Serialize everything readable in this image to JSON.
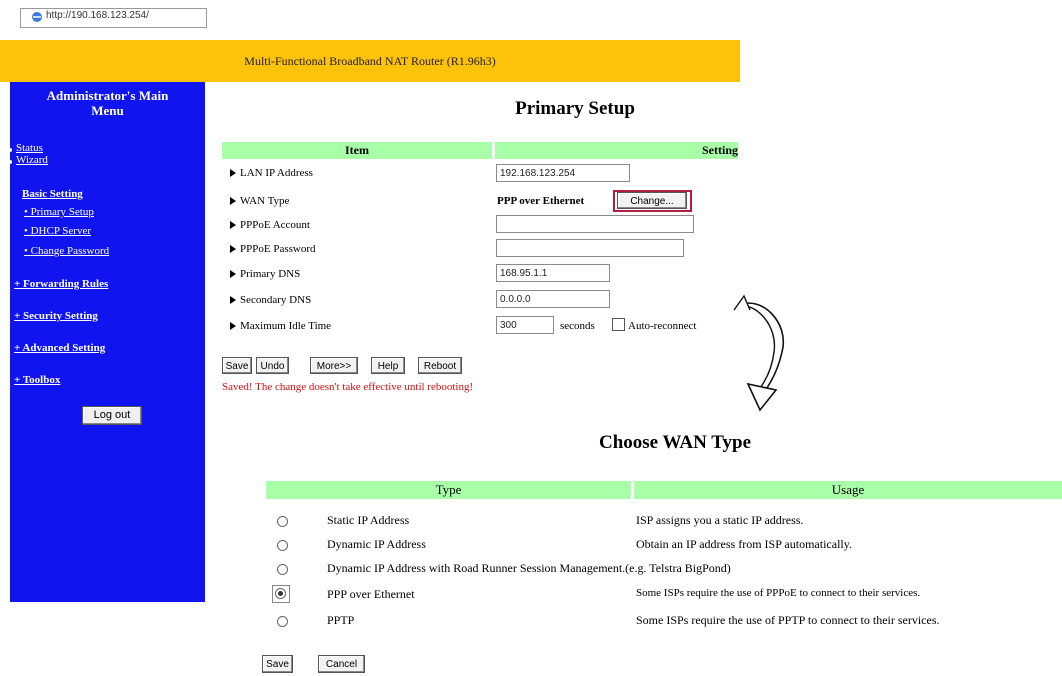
{
  "browser": {
    "url": "http://190.168.123.254/"
  },
  "banner": {
    "text": "Multi-Functional Broadband NAT Router (R1.96h3)"
  },
  "menu": {
    "title_line1": "Administrator's Main",
    "title_line2": "Menu",
    "status": "Status",
    "wizard": "Wizard",
    "basic_setting": "Basic Setting",
    "primary_setup": "Primary Setup",
    "dhcp_server": "DHCP Server",
    "change_password": "Change Password",
    "forwarding_rules": "+ Forwarding Rules",
    "security_setting": "+ Security Setting",
    "advanced_setting": "+ Advanced Setting",
    "toolbox": "+ Toolbox",
    "logout": "Log out"
  },
  "primary_setup": {
    "title": "Primary Setup",
    "col_item": "Item",
    "col_setting": "Setting",
    "rows": [
      {
        "label": "LAN IP Address",
        "value": "192.168.123.254"
      },
      {
        "label": "WAN Type",
        "value": "PPP over Ethernet"
      },
      {
        "label": "PPPoE Account",
        "value": ""
      },
      {
        "label": "PPPoE Password",
        "value": ""
      },
      {
        "label": "Primary DNS",
        "value": "168.95.1.1"
      },
      {
        "label": "Secondary DNS",
        "value": "0.0.0.0"
      },
      {
        "label": "Maximum Idle Time",
        "value": "300"
      }
    ],
    "change_button": "Change...",
    "seconds_label": "seconds",
    "auto_reconnect_label": "Auto-reconnect",
    "auto_reconnect_checked": false,
    "buttons": {
      "save": "Save",
      "undo": "Undo",
      "more": "More>>",
      "help": "Help",
      "reboot": "Reboot"
    },
    "saved_message": "Saved! The change doesn't take effective until rebooting!"
  },
  "choose_wan": {
    "title": "Choose WAN Type",
    "col_type": "Type",
    "col_usage": "Usage",
    "rows": [
      {
        "type": "Static IP Address",
        "usage": "ISP assigns you a static IP address.",
        "selected": false
      },
      {
        "type": "Dynamic IP Address",
        "usage": "Obtain an IP address from ISP automatically.",
        "selected": false
      },
      {
        "type": "Dynamic IP Address with Road Runner Session Management.(e.g. Telstra BigPond)",
        "usage": "",
        "selected": false
      },
      {
        "type": "PPP over Ethernet",
        "usage": "Some ISPs require the use of PPPoE to connect to their services.",
        "selected": true
      },
      {
        "type": "PPTP",
        "usage": "Some ISPs require the use of PPTP to connect to their services.",
        "selected": false
      }
    ],
    "buttons": {
      "save": "Save",
      "cancel": "Cancel"
    }
  },
  "colors": {
    "menu_bg": "#1015f0",
    "banner_bg": "#fdc20a",
    "table_header_bg": "#a8ffa8",
    "message_red": "#d01010"
  }
}
